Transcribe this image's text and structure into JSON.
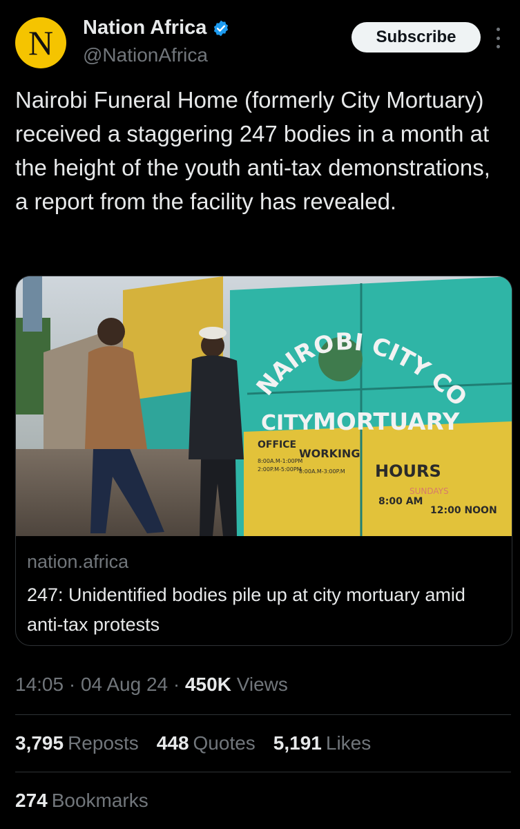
{
  "author": {
    "avatar_letter": "N",
    "name": "Nation Africa",
    "verified_icon": "verified-badge-icon",
    "handle": "@NationAfrica"
  },
  "subscribe_label": "Subscribe",
  "tweet_text": "Nairobi Funeral Home (formerly City Mortuary) received a staggering 247 bodies in a month at the height of the youth anti-tax demonstrations, a report from the facility has revealed.",
  "card": {
    "domain": "nation.africa",
    "title": "247: Unidentified bodies pile up at city mortuary amid anti-tax protests",
    "photo_text": {
      "arc": "NAIROBI CITY COUNCIL",
      "city": "CITY",
      "mortuary": "MORTUARY",
      "office": "OFFICE",
      "working": "WORKING",
      "hours": "HOURS",
      "time1": "8:00 AM",
      "time2": "12:00 NOON",
      "small1": "8:00A.M-1:00PM",
      "small2": "2:00P.M-5:00PM",
      "small3": "8:00A.M-3:00P.M",
      "sundays": "SUNDAYS"
    }
  },
  "meta": {
    "time": "14:05",
    "date": "04 Aug 24",
    "views_count": "450K",
    "views_label": "Views"
  },
  "stats": {
    "reposts_count": "3,795",
    "reposts_label": "Reposts",
    "quotes_count": "448",
    "quotes_label": "Quotes",
    "likes_count": "5,191",
    "likes_label": "Likes",
    "bookmarks_count": "274",
    "bookmarks_label": "Bookmarks"
  },
  "colors": {
    "background": "#000000",
    "avatar_yellow": "#f5c400",
    "verified_blue": "#1d9bf0",
    "muted": "#71767b",
    "divider": "#2f3336"
  }
}
